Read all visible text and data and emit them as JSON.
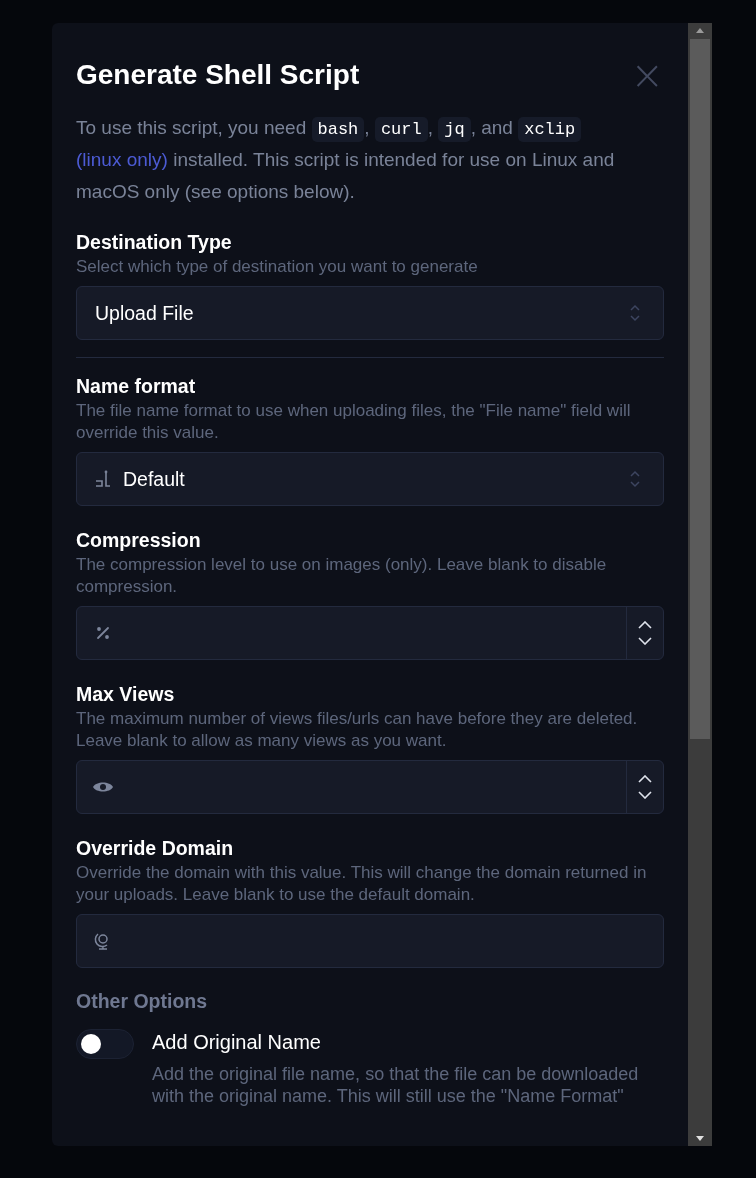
{
  "dialog": {
    "title": "Generate Shell Script",
    "close": "×",
    "intro": [
      {
        "kind": "text",
        "text": "To use this script, you need "
      },
      {
        "kind": "code",
        "text": "bash"
      },
      {
        "kind": "text",
        "text": ", "
      },
      {
        "kind": "code",
        "text": "curl"
      },
      {
        "kind": "text",
        "text": ", "
      },
      {
        "kind": "code",
        "text": "jq"
      },
      {
        "kind": "text",
        "text": ", and "
      },
      {
        "kind": "code",
        "text": "xclip"
      },
      {
        "kind": "link",
        "text": "(linux only)"
      },
      {
        "kind": "text",
        "text": " installed. This script is intended for use on Linux and macOS only (see options below)."
      }
    ],
    "fields": [
      {
        "kind": "select",
        "label": "Destination Type",
        "help": "Select which type of destination you want to generate",
        "value": "Upload File"
      },
      {
        "kind": "select",
        "label": "Name format",
        "help": "The file name format to use when uploading files, the \"File name\" field will override this value.",
        "value": "Default"
      },
      {
        "kind": "number",
        "label": "Compression",
        "help": "The compression level to use on images (only). Leave blank to disable compression."
      },
      {
        "kind": "number",
        "label": "Max Views",
        "help": "The maximum number of views files/urls can have before they are deleted. Leave blank to allow as many views as you want."
      },
      {
        "kind": "text",
        "label": "Override Domain",
        "help": "Override the domain with this value. This will change the domain returned in your uploads. Leave blank to use the default domain."
      }
    ],
    "section": "Other Options",
    "options": [
      {
        "label": "Add Original Name",
        "on": false,
        "help": "Add the original file name, so that the file can be downloaded with the original name. This will still use the \"Name Format\""
      }
    ]
  }
}
